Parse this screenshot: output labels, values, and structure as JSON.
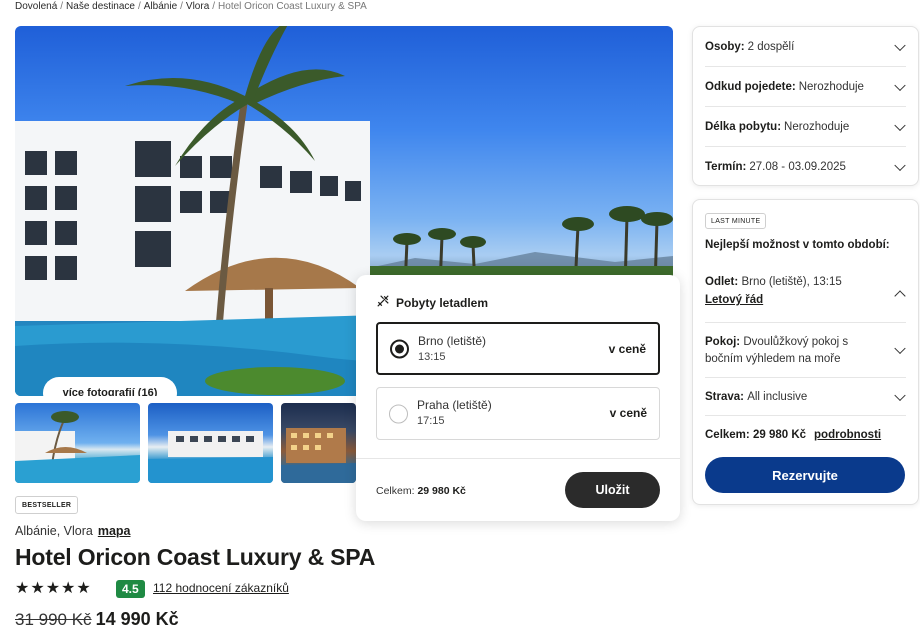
{
  "breadcrumb": {
    "items": [
      "Dovolená",
      "Naše destinace",
      "Albánie",
      "Vlora"
    ],
    "separator": "/",
    "current": "Hotel Oricon Coast Luxury & SPA"
  },
  "gallery": {
    "more_photos_label": "více fotografií (16)"
  },
  "hotel": {
    "badge": "BESTSELLER",
    "location": "Albánie, Vlora",
    "map_link": "mapa",
    "name": "Hotel Oricon Coast Luxury & SPA",
    "stars": 5,
    "star_glyph": "★",
    "rating": "4.5",
    "reviews_label": "112 hodnocení zákazníků",
    "old_price": "31 990 Kč",
    "price": "14 990 Kč"
  },
  "selectors": [
    {
      "label": "Osoby:",
      "value": "2 dospělí"
    },
    {
      "label": "Odkud pojedete:",
      "value": "Nerozhoduje"
    },
    {
      "label": "Délka pobytu:",
      "value": "Nerozhoduje"
    },
    {
      "label": "Termín:",
      "value": "27.08 - 03.09.2025"
    }
  ],
  "offer": {
    "badge": "LAST MINUTE",
    "heading": "Nejlepší možnost v tomto období:",
    "departure_label": "Odlet:",
    "departure_value": "Brno (letiště), 13:15",
    "flight_schedule_link": "Letový řád",
    "room_label": "Pokoj:",
    "room_value": "Dvoulůžkový pokoj s bočním výhledem na moře",
    "board_label": "Strava:",
    "board_value": "All inclusive",
    "total_label": "Celkem:",
    "total_value": "29 980 Kč",
    "details_link": "podrobnosti",
    "reserve_label": "Rezervujte"
  },
  "flight_popup": {
    "title": "Pobyty letadlem",
    "options": [
      {
        "city": "Brno (letiště)",
        "time": "13:15",
        "price": "v ceně",
        "selected": true
      },
      {
        "city": "Praha (letiště)",
        "time": "17:15",
        "price": "v ceně",
        "selected": false
      }
    ],
    "total_label": "Celkem:",
    "total_value": "29 980 Kč",
    "save_label": "Uložit"
  },
  "colors": {
    "reserve_button": "#0a3a8c",
    "rating_badge": "#1f8a43",
    "save_button": "#2b2b2b"
  }
}
